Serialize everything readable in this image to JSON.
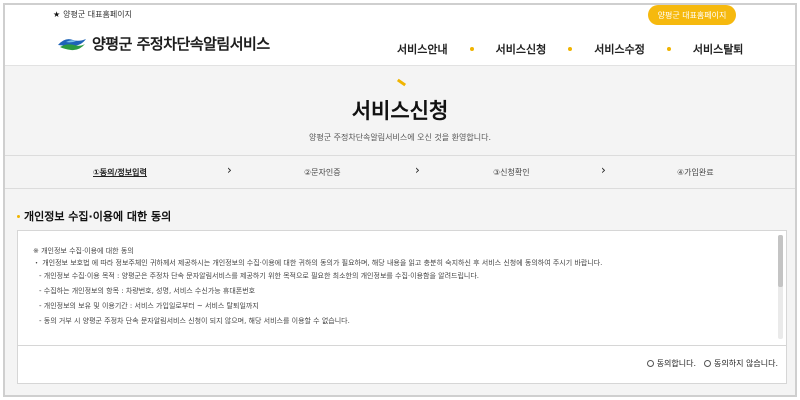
{
  "header": {
    "top_link": "양평군 대표홈페이지",
    "home_button": "양평군 대표홈페이지",
    "logo_text": "양평군 주정차단속알림서비스",
    "nav": [
      "서비스안내",
      "서비스신청",
      "서비스수정",
      "서비스탈퇴"
    ]
  },
  "page": {
    "title": "서비스신청",
    "subtitle": "양평군 주정차단속알림서비스에 오신 것을 환영합니다."
  },
  "steps": [
    "①동의/정보입력",
    "②문자인증",
    "③신청확인",
    "④가입완료"
  ],
  "section": {
    "title": "개인정보 수집·이용에 대한 동의",
    "notice_heading": "※ 개인정보 수집·이용에 대한 동의",
    "notice_intro": "・ 개인정보 보호법 에 따라 정보주체인 귀하께서 제공하시는 개인정보의 수집·이용에 대한 귀하의 동의가 필요하며, 해당 내용을 읽고 충분히 숙지하신 후 서비스 신청에 동의하여 주시기 바랍니다.",
    "items": [
      "- 개인정보 수집·이용 목적 : 양평군은 주정차 단속 문자알림서비스를 제공하기 위한 목적으로 필요한 최소한의 개인정보를 수집·이용함을 알려드립니다.",
      "- 수집하는 개인정보의 항목 : 차량번호, 성명, 서비스 수신가능 휴대폰번호",
      "- 개인정보의 보유 및 이용기간 : 서비스 가입일로부터 ~ 서비스 탈퇴일까지",
      "- 동의 거부 시 양평군 주정차 단속 문자알림서비스 신청이 되지 않으며, 해당 서비스를 이용할 수 없습니다."
    ]
  },
  "agree": {
    "agree_label": "동의합니다.",
    "disagree_label": "동의하지 않습니다."
  },
  "colors": {
    "accent": "#f0b400",
    "button": "#f6b90e"
  }
}
